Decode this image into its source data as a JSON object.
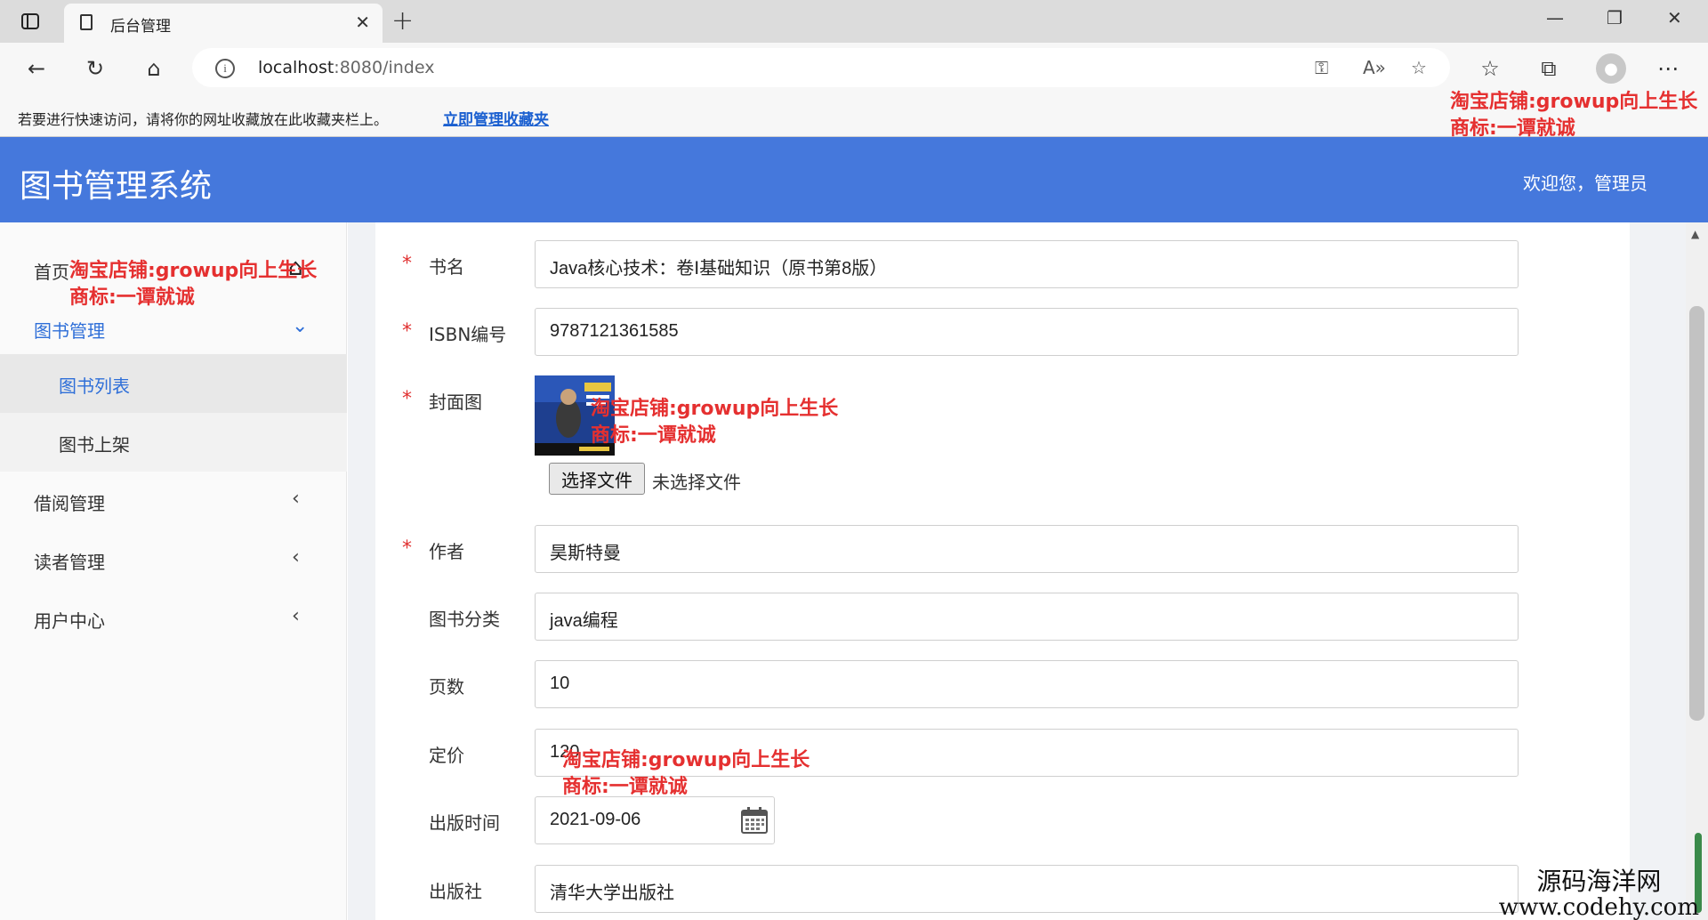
{
  "browser": {
    "tab_title": "后台管理",
    "url_host": "localhost",
    "url_path": ":8080/index",
    "fav_message": "若要进行快速访问，请将你的网址收藏放在此收藏夹栏上。",
    "fav_link": "立即管理收藏夹"
  },
  "app": {
    "title": "图书管理系统",
    "welcome": "欢迎您，管理员"
  },
  "sidebar": {
    "home": "首页",
    "book_manage": "图书管理",
    "book_list": "图书列表",
    "book_shelve": "图书上架",
    "borrow_manage": "借阅管理",
    "reader_manage": "读者管理",
    "user_center": "用户中心"
  },
  "form": {
    "name_label": "书名",
    "name_value": "Java核心技术：卷Ⅰ基础知识（原书第8版）",
    "isbn_label": "ISBN编号",
    "isbn_value": "9787121361585",
    "cover_label": "封面图",
    "file_button": "选择文件",
    "file_status": "未选择文件",
    "author_label": "作者",
    "author_value": "昊斯特曼",
    "category_label": "图书分类",
    "category_value": "java编程",
    "pages_label": "页数",
    "pages_value": "10",
    "price_label": "定价",
    "price_value": "120",
    "pubdate_label": "出版时间",
    "pubdate_value": "2021-09-06",
    "publisher_label": "出版社",
    "publisher_value": "清华大学出版社",
    "required_mark": "*"
  },
  "watermarks": {
    "shop": "淘宝店铺:growup向上生长",
    "brand": "商标:一谭就诚",
    "corner_line1": "源码海洋网",
    "corner_line2": "www.codehy.com"
  },
  "colors": {
    "header_blue": "#4578dc",
    "active_link": "#2f6fd8",
    "required_red": "#e03030",
    "watermark_red": "#e53030"
  }
}
